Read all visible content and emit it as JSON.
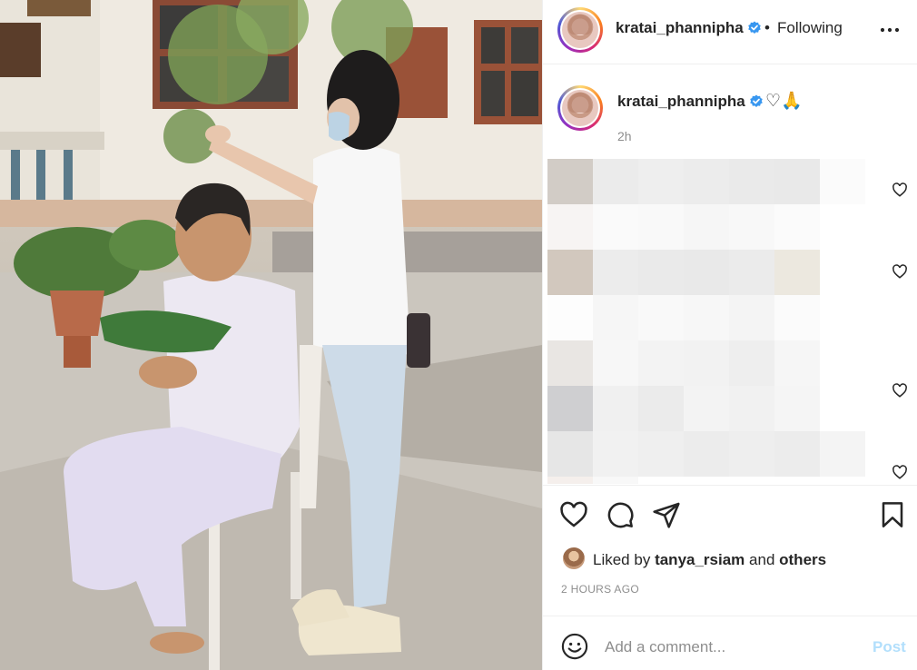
{
  "post": {
    "username": "kratai_phannipha",
    "follow_status": "Following",
    "separator": "•",
    "more_icon": "more-horizontal-icon",
    "verified_icon": "verified-badge-icon"
  },
  "caption": {
    "username": "kratai_phannipha",
    "text": "♡🙏",
    "time": "2h"
  },
  "actions": {
    "icons": [
      "heart-icon",
      "comment-icon",
      "share-icon",
      "bookmark-icon"
    ]
  },
  "likes": {
    "prefix": "Liked by",
    "user": "tanya_rsiam",
    "conjunction": "and",
    "others": "others"
  },
  "timestamp": "2 HOURS AGO",
  "comment_box": {
    "placeholder": "Add a comment...",
    "post_label": "Post"
  },
  "colors": {
    "accent_disabled": "#b2dffc",
    "muted": "#8e8e8e",
    "text": "#262626",
    "verified": "#3897f0"
  }
}
